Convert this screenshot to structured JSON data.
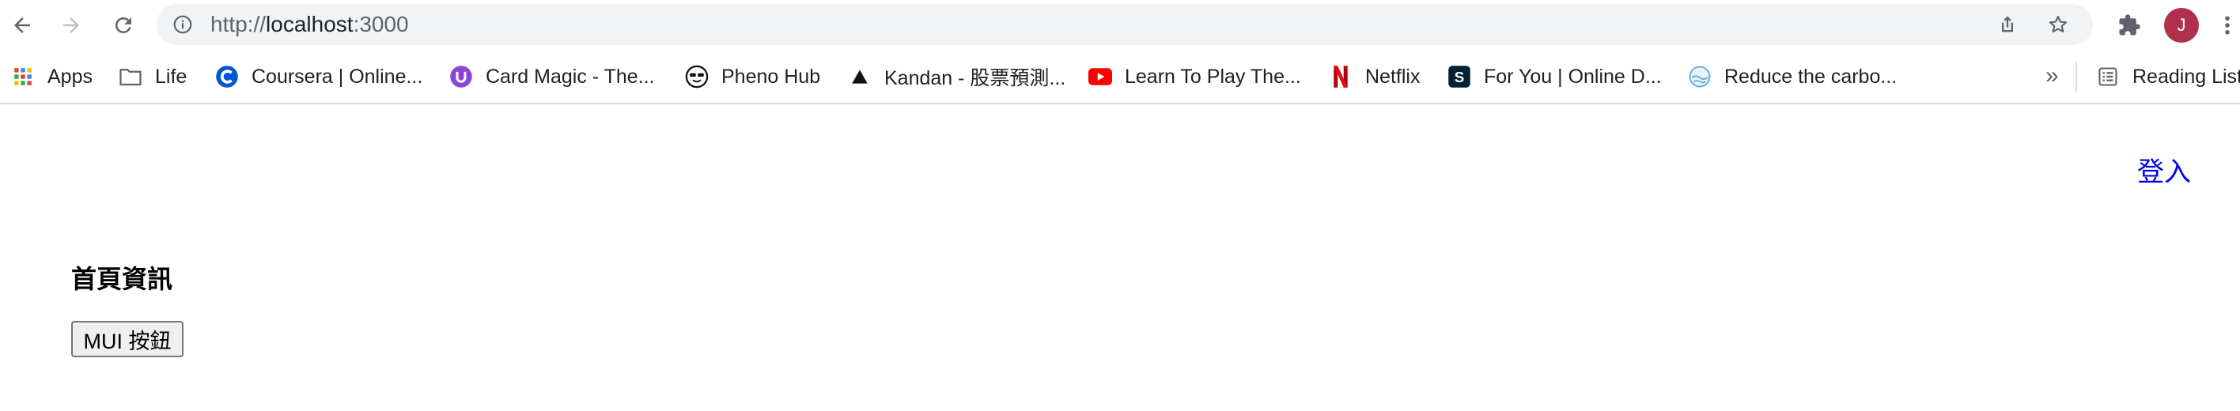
{
  "browser": {
    "url_scheme": "http://",
    "url_host": "localhost",
    "url_port": ":3000",
    "profile_initial": "J"
  },
  "bookmarks": {
    "items": [
      {
        "label": "Apps",
        "icon": "apps-grid-icon"
      },
      {
        "label": "Life",
        "icon": "folder-icon"
      },
      {
        "label": "Coursera | Online...",
        "icon": "coursera-icon"
      },
      {
        "label": "Card Magic - The...",
        "icon": "card-magic-icon"
      },
      {
        "label": "Pheno Hub",
        "icon": "pheno-hub-icon"
      },
      {
        "label": "Kandan - 股票預測...",
        "icon": "kandan-icon"
      },
      {
        "label": "Learn To Play The...",
        "icon": "youtube-icon"
      },
      {
        "label": "Netflix",
        "icon": "netflix-icon"
      },
      {
        "label": "For You | Online D...",
        "icon": "skillshare-icon"
      },
      {
        "label": "Reduce the carbo...",
        "icon": "globe-icon"
      }
    ],
    "overflow": "»",
    "reading_list": "Reading List"
  },
  "page": {
    "login_link": "登入",
    "title": "首頁資訊",
    "button_label": "MUI 按鈕"
  },
  "colors": {
    "link": "#0000ee",
    "avatar": "#b0304a",
    "omnibox": "#f1f3f4"
  }
}
